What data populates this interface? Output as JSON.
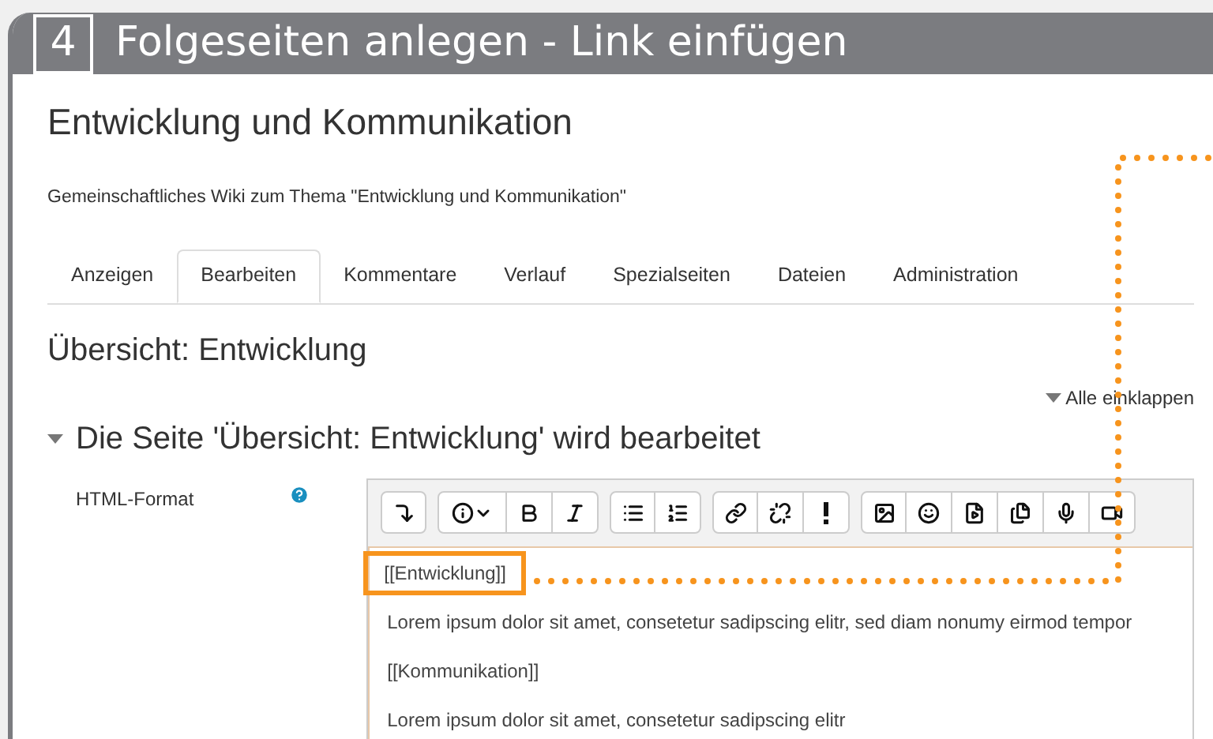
{
  "step": {
    "number": "4",
    "title": "Folgeseiten anlegen - Link einfügen"
  },
  "wiki": {
    "title": "Entwicklung und Kommunikation",
    "description": "Gemeinschaftliches Wiki zum Thema \"Entwicklung und Kommunikation\""
  },
  "tabs": [
    {
      "label": "Anzeigen",
      "selected": false
    },
    {
      "label": "Bearbeiten",
      "selected": true
    },
    {
      "label": "Kommentare",
      "selected": false
    },
    {
      "label": "Verlauf",
      "selected": false
    },
    {
      "label": "Spezialseiten",
      "selected": false
    },
    {
      "label": "Dateien",
      "selected": false
    },
    {
      "label": "Administration",
      "selected": false
    }
  ],
  "page_title": "Übersicht: Entwicklung",
  "collapse_all": "Alle einklappen",
  "section": {
    "title": "Die Seite 'Übersicht: Entwicklung' wird bearbeitet",
    "expanded": true
  },
  "format_label": "HTML-Format",
  "editor": {
    "toolbar_groups": [
      [
        {
          "kind": "expand"
        }
      ],
      [
        {
          "kind": "info"
        },
        {
          "kind": "bold"
        },
        {
          "kind": "italic"
        }
      ],
      [
        {
          "kind": "bullets"
        },
        {
          "kind": "numbers"
        }
      ],
      [
        {
          "kind": "link"
        },
        {
          "kind": "unlink"
        },
        {
          "kind": "nolink"
        }
      ],
      [
        {
          "kind": "image"
        },
        {
          "kind": "emoji"
        },
        {
          "kind": "media"
        },
        {
          "kind": "files"
        },
        {
          "kind": "audio"
        },
        {
          "kind": "video"
        }
      ]
    ],
    "lines": [
      {
        "text": "[[Entwicklung]]",
        "highlighted": true
      },
      {
        "text": "Lorem ipsum dolor sit amet, consetetur sadipscing elitr, sed diam nonumy eirmod tempor",
        "highlighted": false
      },
      {
        "text": "[[Kommunikation]]",
        "highlighted": false
      },
      {
        "text": "Lorem ipsum dolor sit amet, consetetur sadipscing elitr",
        "highlighted": false
      }
    ]
  }
}
